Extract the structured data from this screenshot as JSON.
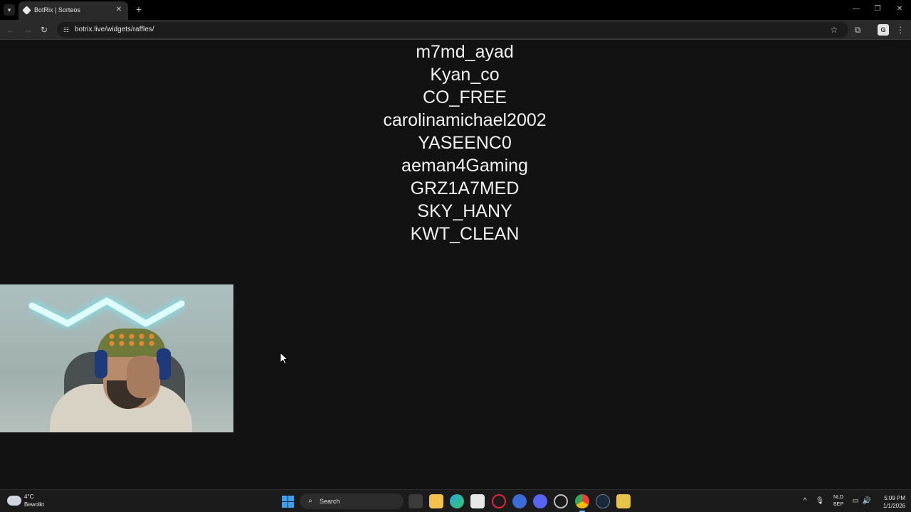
{
  "browser": {
    "tab_title": "BotRix | Sorteos",
    "url": "botrix.live/widgets/raffles/",
    "icons": {
      "tab_list": "chevron-down-icon",
      "close_tab": "close-icon",
      "new_tab": "plus-icon",
      "back": "arrow-left-icon",
      "forward": "arrow-right-icon",
      "reload": "reload-icon",
      "site_info": "tune-icon",
      "bookmark": "star-icon",
      "extensions": "puzzle-icon",
      "menu": "kebab-icon"
    }
  },
  "raffle": {
    "winners": [
      "m7md_ayad",
      "Kyan_co",
      "CO_FREE",
      "carolinamichael2002",
      "YASEENC0",
      "aeman4Gaming",
      "GRZ1A7MED",
      "SKY_HANY",
      "KWT_CLEAN"
    ]
  },
  "taskbar": {
    "weather": {
      "temp": "4°C",
      "condition": "Bewolkt"
    },
    "search_label": "Search",
    "language": {
      "line1": "NLD",
      "line2": "BEP"
    },
    "clock": {
      "time": "5:09 PM",
      "date": "1/1/2026"
    }
  },
  "colors": {
    "page_background": "#121212",
    "text": "#f2f2f2",
    "accent": "#3aa0f3"
  }
}
